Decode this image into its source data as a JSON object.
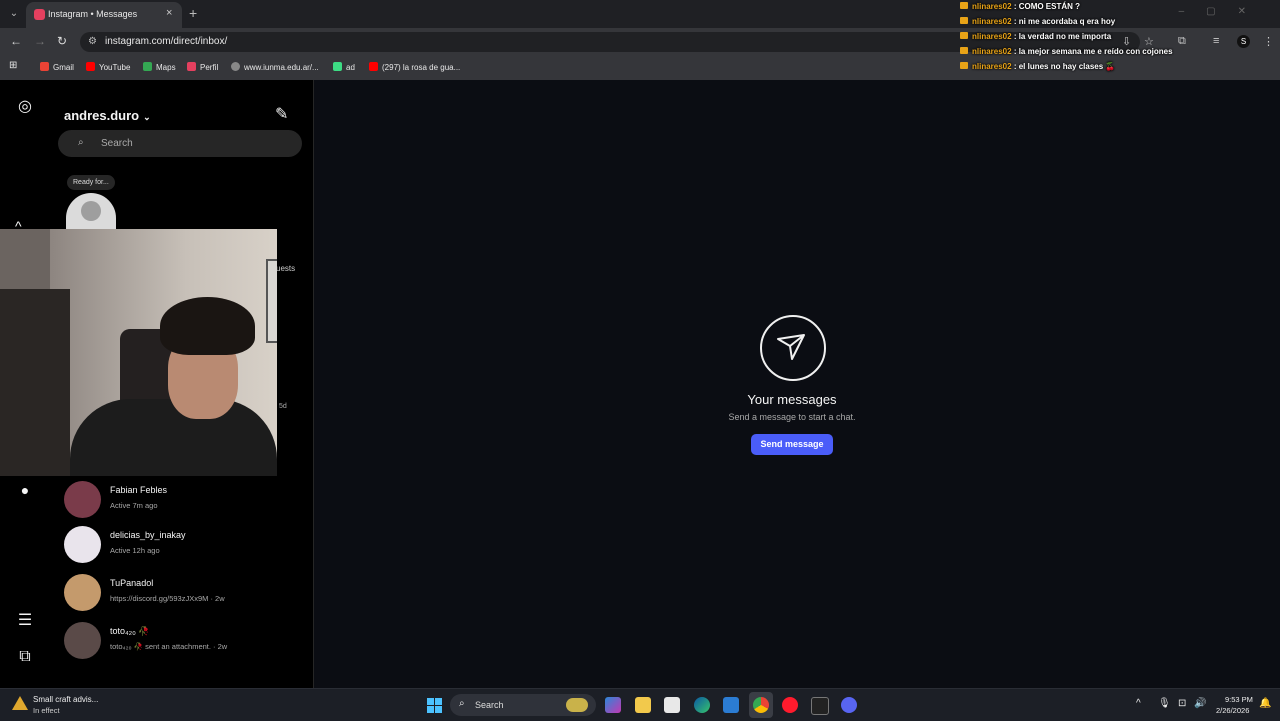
{
  "browser": {
    "tab_title": "Instagram • Messages",
    "tab_close": "×",
    "new_tab": "+",
    "url": "instagram.com/direct/inbox/",
    "bookmarks": [
      {
        "label": "Gmail",
        "color": "#ea4335"
      },
      {
        "label": "YouTube",
        "color": "#ff0000"
      },
      {
        "label": "Maps",
        "color": "#34a853"
      },
      {
        "label": "Perfil",
        "color": "#e4405f"
      },
      {
        "label": "www.iunma.edu.ar/...",
        "color": "#888888"
      },
      {
        "label": "ad",
        "color": "#3ddc84"
      },
      {
        "label": "(297) la rosa de gua...",
        "color": "#ff0000"
      }
    ]
  },
  "chat_overlay": [
    {
      "user": "nlinares02",
      "message": ": COMO ESTÁN ?"
    },
    {
      "user": "nlinares02",
      "message": ": ni me acordaba q era hoy"
    },
    {
      "user": "nlinares02",
      "message": ": la verdad no me importa"
    },
    {
      "user": "nlinares02",
      "message": ": la mejor semana me e reído con cojones"
    },
    {
      "user": "nlinares02",
      "message": ": el lunes no hay clases 🍒"
    }
  ],
  "inbox": {
    "username": "andres.duro",
    "search_placeholder": "Search",
    "note_text": "Ready for...",
    "requests_fragment": "uests",
    "time_fragment": "5d",
    "conversations": [
      {
        "name": "Fabian Febles",
        "sub": "Active 7m ago",
        "color": "#7a3b4a"
      },
      {
        "name": "delicias_by_inakay",
        "sub": "Active 12h ago",
        "color": "#e9e4ec"
      },
      {
        "name": "TuPanadol",
        "sub": "https://discord.gg/593zJXx9M · 2w",
        "color": "#c49a6c"
      },
      {
        "name": "toto₄₂₀ 🥀",
        "sub": "toto₄₂₀ 🥀 sent an attachment. · 2w",
        "color": "#5a4a48"
      }
    ]
  },
  "main": {
    "title": "Your messages",
    "subtitle": "Send a message to start a chat.",
    "button": "Send message",
    "accent": "#4a5df9"
  },
  "taskbar": {
    "weather_title": "Small craft advis...",
    "weather_sub": "In effect",
    "search_label": "Search",
    "time": "9:53 PM",
    "date": "2/26/2026"
  }
}
